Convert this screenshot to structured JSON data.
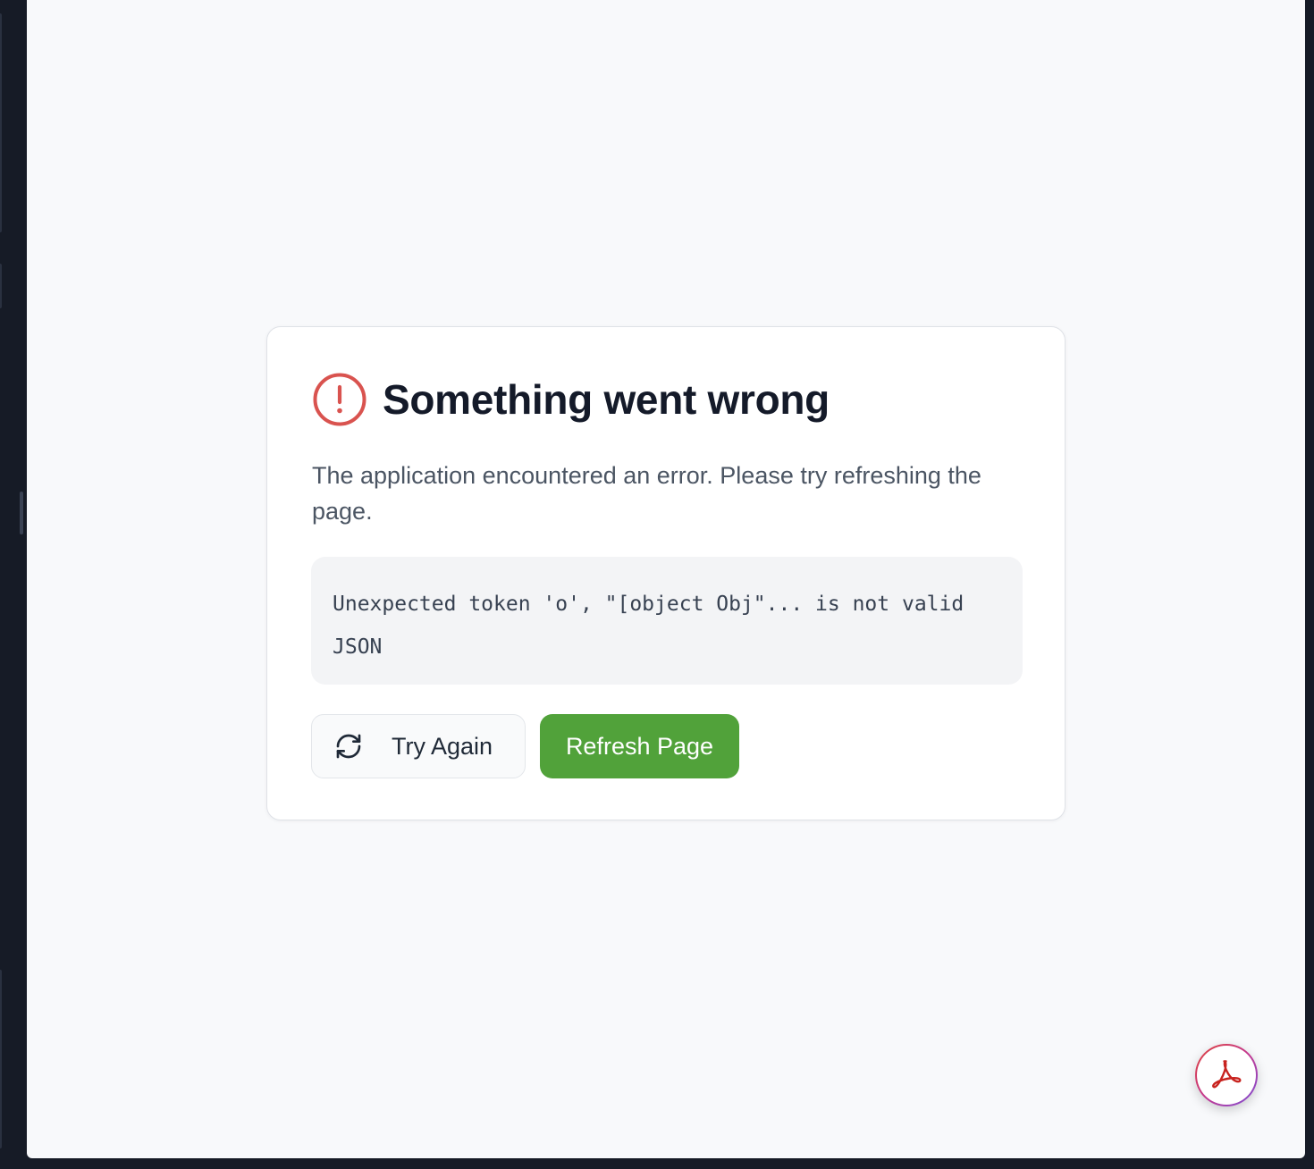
{
  "error_card": {
    "title": "Something went wrong",
    "title_icon": "alert-circle-icon",
    "description": "The application encountered an error. Please try refreshing the page.",
    "error_message": "Unexpected token 'o', \"[object Obj\"... is not valid JSON",
    "actions": {
      "try_again_label": "Try Again",
      "try_again_icon": "refresh-icon",
      "refresh_label": "Refresh Page"
    }
  },
  "floating_button": {
    "icon": "acrobat-pdf-icon"
  },
  "colors": {
    "error": "#d9534f",
    "primary_button": "#51a23a",
    "title_text": "#141a29",
    "page_background": "#f8f9fb",
    "app_frame": "#161b26"
  }
}
